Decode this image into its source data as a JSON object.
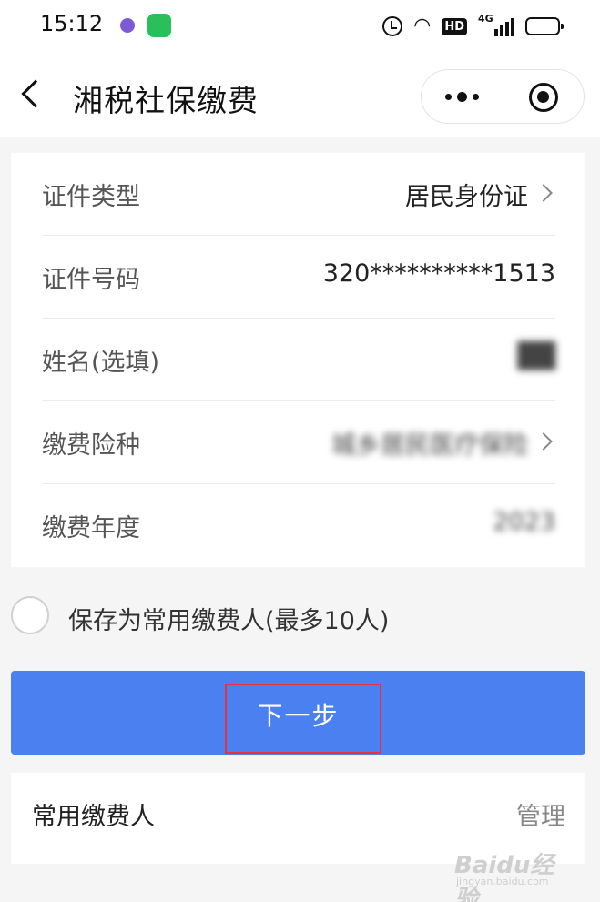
{
  "status_bar": {
    "time": "15:12",
    "hd": "HD",
    "network": "4G",
    "icons": [
      "app-notification-icon",
      "app-store-icon",
      "alarm-icon",
      "wifi-icon",
      "signal-icon",
      "battery-icon"
    ]
  },
  "nav": {
    "title": "湘税社保缴费",
    "icons": [
      "back-icon",
      "more-icon",
      "close-icon"
    ]
  },
  "form": {
    "rows": [
      {
        "label": "证件类型",
        "value": "居民身份证",
        "arrow": true
      },
      {
        "label": "证件号码",
        "value": "320**********1513",
        "arrow": false
      },
      {
        "label": "姓名(选填)",
        "value": "██",
        "arrow": false
      },
      {
        "label": "缴费险种",
        "value": "城乡居民医疗保险",
        "arrow": true
      },
      {
        "label": "缴费年度",
        "value": "2023",
        "arrow": false
      }
    ]
  },
  "save_option": {
    "label": "保存为常用缴费人(最多10人)",
    "checked": false
  },
  "next_button": {
    "label": "下一步",
    "highlight_color": "#e8323a",
    "color": "#4a80f0"
  },
  "payers": {
    "title": "常用缴费人",
    "manage_label": "管理"
  },
  "watermark": {
    "brand": "Baidu经验",
    "sub": "jingyan.baidu.com"
  }
}
